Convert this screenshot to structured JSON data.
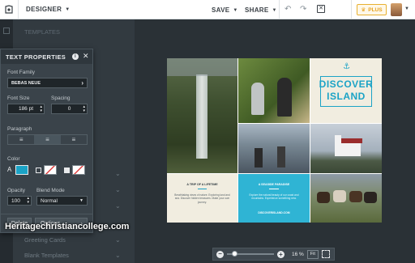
{
  "topbar": {
    "designer_label": "DESIGNER",
    "save_label": "SAVE",
    "share_label": "SHARE",
    "plus_label": "PLUS"
  },
  "panel": {
    "templates_label": "TEMPLATES",
    "categories": [
      "Greeting Cards",
      "Blank Templates"
    ]
  },
  "text_properties": {
    "title": "TEXT PROPERTIES",
    "font_family_label": "Font Family",
    "font_family_value": "BEBAS NEUE",
    "font_size_label": "Font Size",
    "font_size_value": "186 pt",
    "spacing_label": "Spacing",
    "spacing_value": "0",
    "paragraph_label": "Paragraph",
    "color_label": "Color",
    "color_value": "#1ba3c6",
    "opacity_label": "Opacity",
    "opacity_value": "100",
    "blend_label": "Blend Mode",
    "blend_value": "Normal",
    "delete_label": "Delete",
    "options_label": "Options"
  },
  "design": {
    "headline_line1": "DISCOVER",
    "headline_line2": "ISLAND",
    "card1_title": "A TRIP OF A LIFETIME",
    "card1_body": "Breathtaking views of nature. Exploring land and sea. Discover hidden treasures. Make your own journey.",
    "card2_title": "A SEASIDE PARADISE",
    "card2_body": "Explore the natural beauty of our coast and mountains. Experience something new.",
    "card2_link": "DISCOVERISLAND.COM"
  },
  "zoom": {
    "value": "16 %",
    "fit_label": "Fit",
    "level": 0.16
  },
  "watermark": "Heritagechristiancollege.com"
}
